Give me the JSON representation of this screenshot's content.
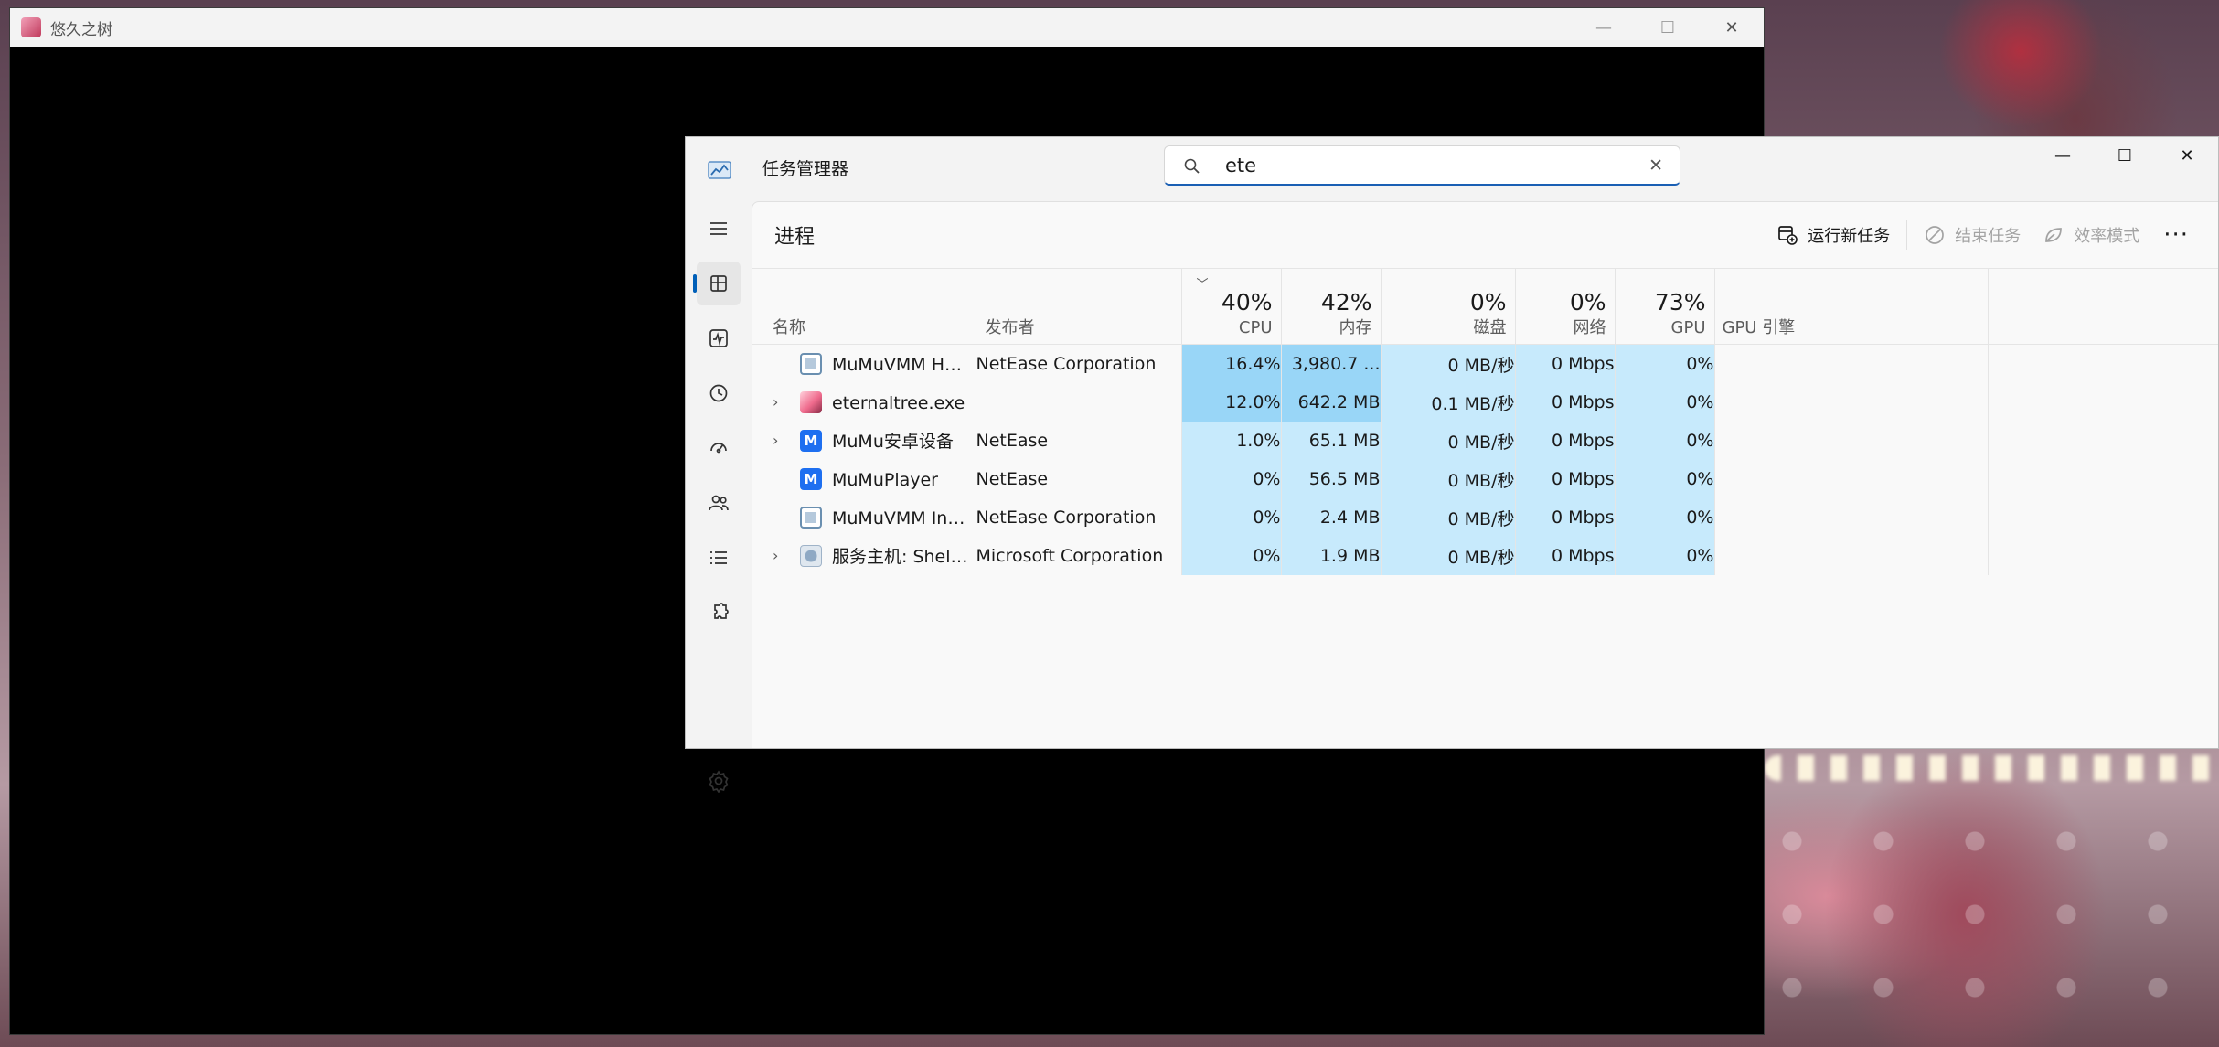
{
  "game_window": {
    "title": "悠久之树",
    "controls": {
      "minimize": "—",
      "maximize": "☐",
      "close": "✕"
    }
  },
  "task_manager": {
    "title": "任务管理器",
    "search": {
      "value": "ete",
      "clear_glyph": "✕"
    },
    "window_controls": {
      "minimize": "—",
      "maximize": "☐",
      "close": "✕"
    },
    "nav": [
      {
        "icon": "hamburger-menu-icon"
      },
      {
        "icon": "processes-icon",
        "active": true
      },
      {
        "icon": "performance-icon"
      },
      {
        "icon": "app-history-icon"
      },
      {
        "icon": "startup-apps-icon"
      },
      {
        "icon": "users-icon"
      },
      {
        "icon": "details-icon"
      },
      {
        "icon": "services-icon"
      },
      {
        "icon": "settings-icon"
      }
    ],
    "page_title": "进程",
    "toolbar": {
      "run_new_task": "运行新任务",
      "end_task": "结束任务",
      "efficiency_mode": "效率模式",
      "more": "···"
    },
    "columns": {
      "name": "名称",
      "publisher": "发布者",
      "cpu": {
        "pct": "40%",
        "label": "CPU"
      },
      "memory": {
        "pct": "42%",
        "label": "内存"
      },
      "disk": {
        "pct": "0%",
        "label": "磁盘"
      },
      "network": {
        "pct": "0%",
        "label": "网络"
      },
      "gpu": {
        "pct": "73%",
        "label": "GPU"
      },
      "gpu_engine": "GPU 引擎",
      "sort_glyph": "﹀"
    },
    "rows": [
      {
        "name": "MuMuVMM He...",
        "publisher": "NetEase Corporation",
        "cpu": "16.4%",
        "memory": "3,980.7 ...",
        "disk": "0 MB/秒",
        "network": "0 Mbps",
        "gpu": "0%",
        "expandable": false,
        "icon": "vmm-icon"
      },
      {
        "name": "eternaltree.exe",
        "publisher": "",
        "cpu": "12.0%",
        "memory": "642.2 MB",
        "disk": "0.1 MB/秒",
        "network": "0 Mbps",
        "gpu": "0%",
        "expandable": true,
        "icon": "eternaltree-icon"
      },
      {
        "name": "MuMu安卓设备",
        "publisher": "NetEase",
        "cpu": "1.0%",
        "memory": "65.1 MB",
        "disk": "0 MB/秒",
        "network": "0 Mbps",
        "gpu": "0%",
        "expandable": true,
        "icon": "mumu-icon"
      },
      {
        "name": "MuMuPlayer",
        "publisher": "NetEase",
        "cpu": "0%",
        "memory": "56.5 MB",
        "disk": "0 MB/秒",
        "network": "0 Mbps",
        "gpu": "0%",
        "expandable": false,
        "icon": "mumu-icon"
      },
      {
        "name": "MuMuVMM Int...",
        "publisher": "NetEase Corporation",
        "cpu": "0%",
        "memory": "2.4 MB",
        "disk": "0 MB/秒",
        "network": "0 Mbps",
        "gpu": "0%",
        "expandable": false,
        "icon": "vmm-icon"
      },
      {
        "name": "服务主机: Shell ...",
        "publisher": "Microsoft Corporation",
        "cpu": "0%",
        "memory": "1.9 MB",
        "disk": "0 MB/秒",
        "network": "0 Mbps",
        "gpu": "0%",
        "expandable": true,
        "icon": "service-host-icon"
      }
    ],
    "colors": {
      "heat_high": "#99d6f7",
      "heat_low": "#c7eafc",
      "accent": "#005fb8"
    }
  }
}
